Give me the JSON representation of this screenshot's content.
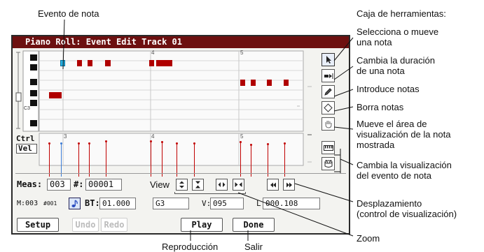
{
  "annotations": {
    "evento_nota": "Evento de nota",
    "caja_herramientas": "Caja de herramientas:",
    "selecciona": [
      "Selecciona o mueve",
      "una nota"
    ],
    "cambia_duracion": [
      "Cambia la duración",
      "de una nota"
    ],
    "introduce": "Introduce notas",
    "borra": "Borra notas",
    "mueve_area": [
      "Mueve el área de",
      "visualización de la nota",
      "mostrada"
    ],
    "cambia_visualizacion": [
      "Cambia la visualización",
      "del evento de nota"
    ],
    "desplazamiento": [
      "Desplazamiento",
      "(control de visualización)"
    ],
    "zoom": "Zoom",
    "reproduccion": "Reproducción",
    "salir": "Salir"
  },
  "window": {
    "title": "Piano Roll: Event Edit Track 01",
    "octave_label": "C3",
    "measure_numbers": [
      "4",
      "5"
    ],
    "ctrl_tab": "Ctrl",
    "vel_tab": "Vel",
    "vel_marker_number": "3"
  },
  "controls": {
    "meas_label": "Meas:",
    "meas_value": "003",
    "hash_label": "#:",
    "hash_value": "00001",
    "view_label": "View",
    "m_label": "M:003",
    "hash_small": "#001",
    "bt_label": "BT:",
    "bt_value": "01.000",
    "note_value": "G3",
    "v_label": "V:",
    "v_value": "095",
    "l_label": "L:",
    "l_value": "000.108"
  },
  "buttons": {
    "setup": "Setup",
    "undo": "Undo",
    "redo": "Redo",
    "play": "Play",
    "done": "Done"
  },
  "colors": {
    "title_bg": "#6d1010",
    "note_color": "#b00000",
    "selected_note": "#28b4e6"
  }
}
